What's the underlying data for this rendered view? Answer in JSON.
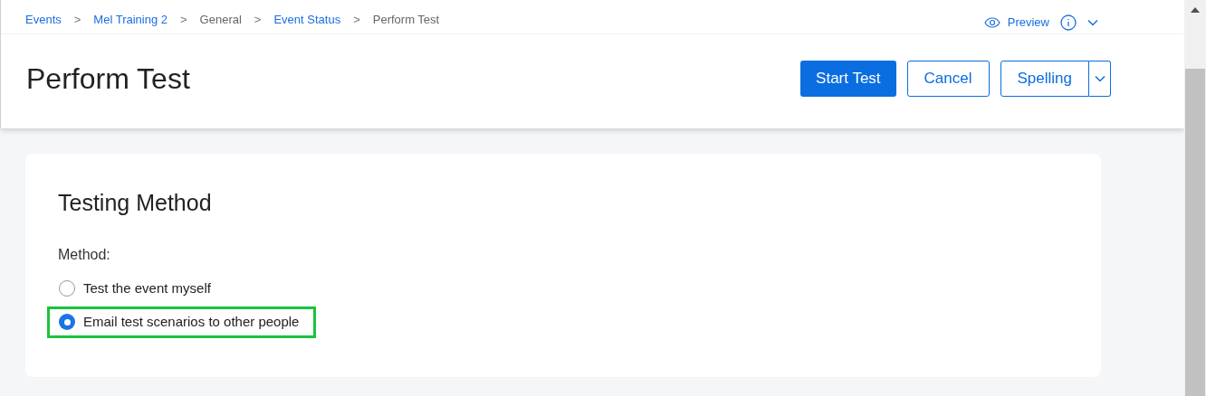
{
  "breadcrumbs": [
    {
      "label": "Events",
      "kind": "link"
    },
    {
      "label": "Mel Training 2",
      "kind": "link"
    },
    {
      "label": "General",
      "kind": "text"
    },
    {
      "label": "Event Status",
      "kind": "link"
    },
    {
      "label": "Perform Test",
      "kind": "text"
    }
  ],
  "breadcrumb_separator": ">",
  "preview": {
    "label": "Preview"
  },
  "page_title": "Perform Test",
  "actions": [
    {
      "label": "Start Test",
      "kind": "primary"
    },
    {
      "label": "Cancel",
      "kind": "secondary"
    },
    {
      "label": "Spelling",
      "kind": "split"
    }
  ],
  "section": {
    "title": "Testing Method",
    "field_label": "Method:",
    "options": [
      {
        "label": "Test the event myself",
        "selected": false,
        "highlighted": false
      },
      {
        "label": "Email test scenarios to other people",
        "selected": true,
        "highlighted": true
      }
    ]
  }
}
